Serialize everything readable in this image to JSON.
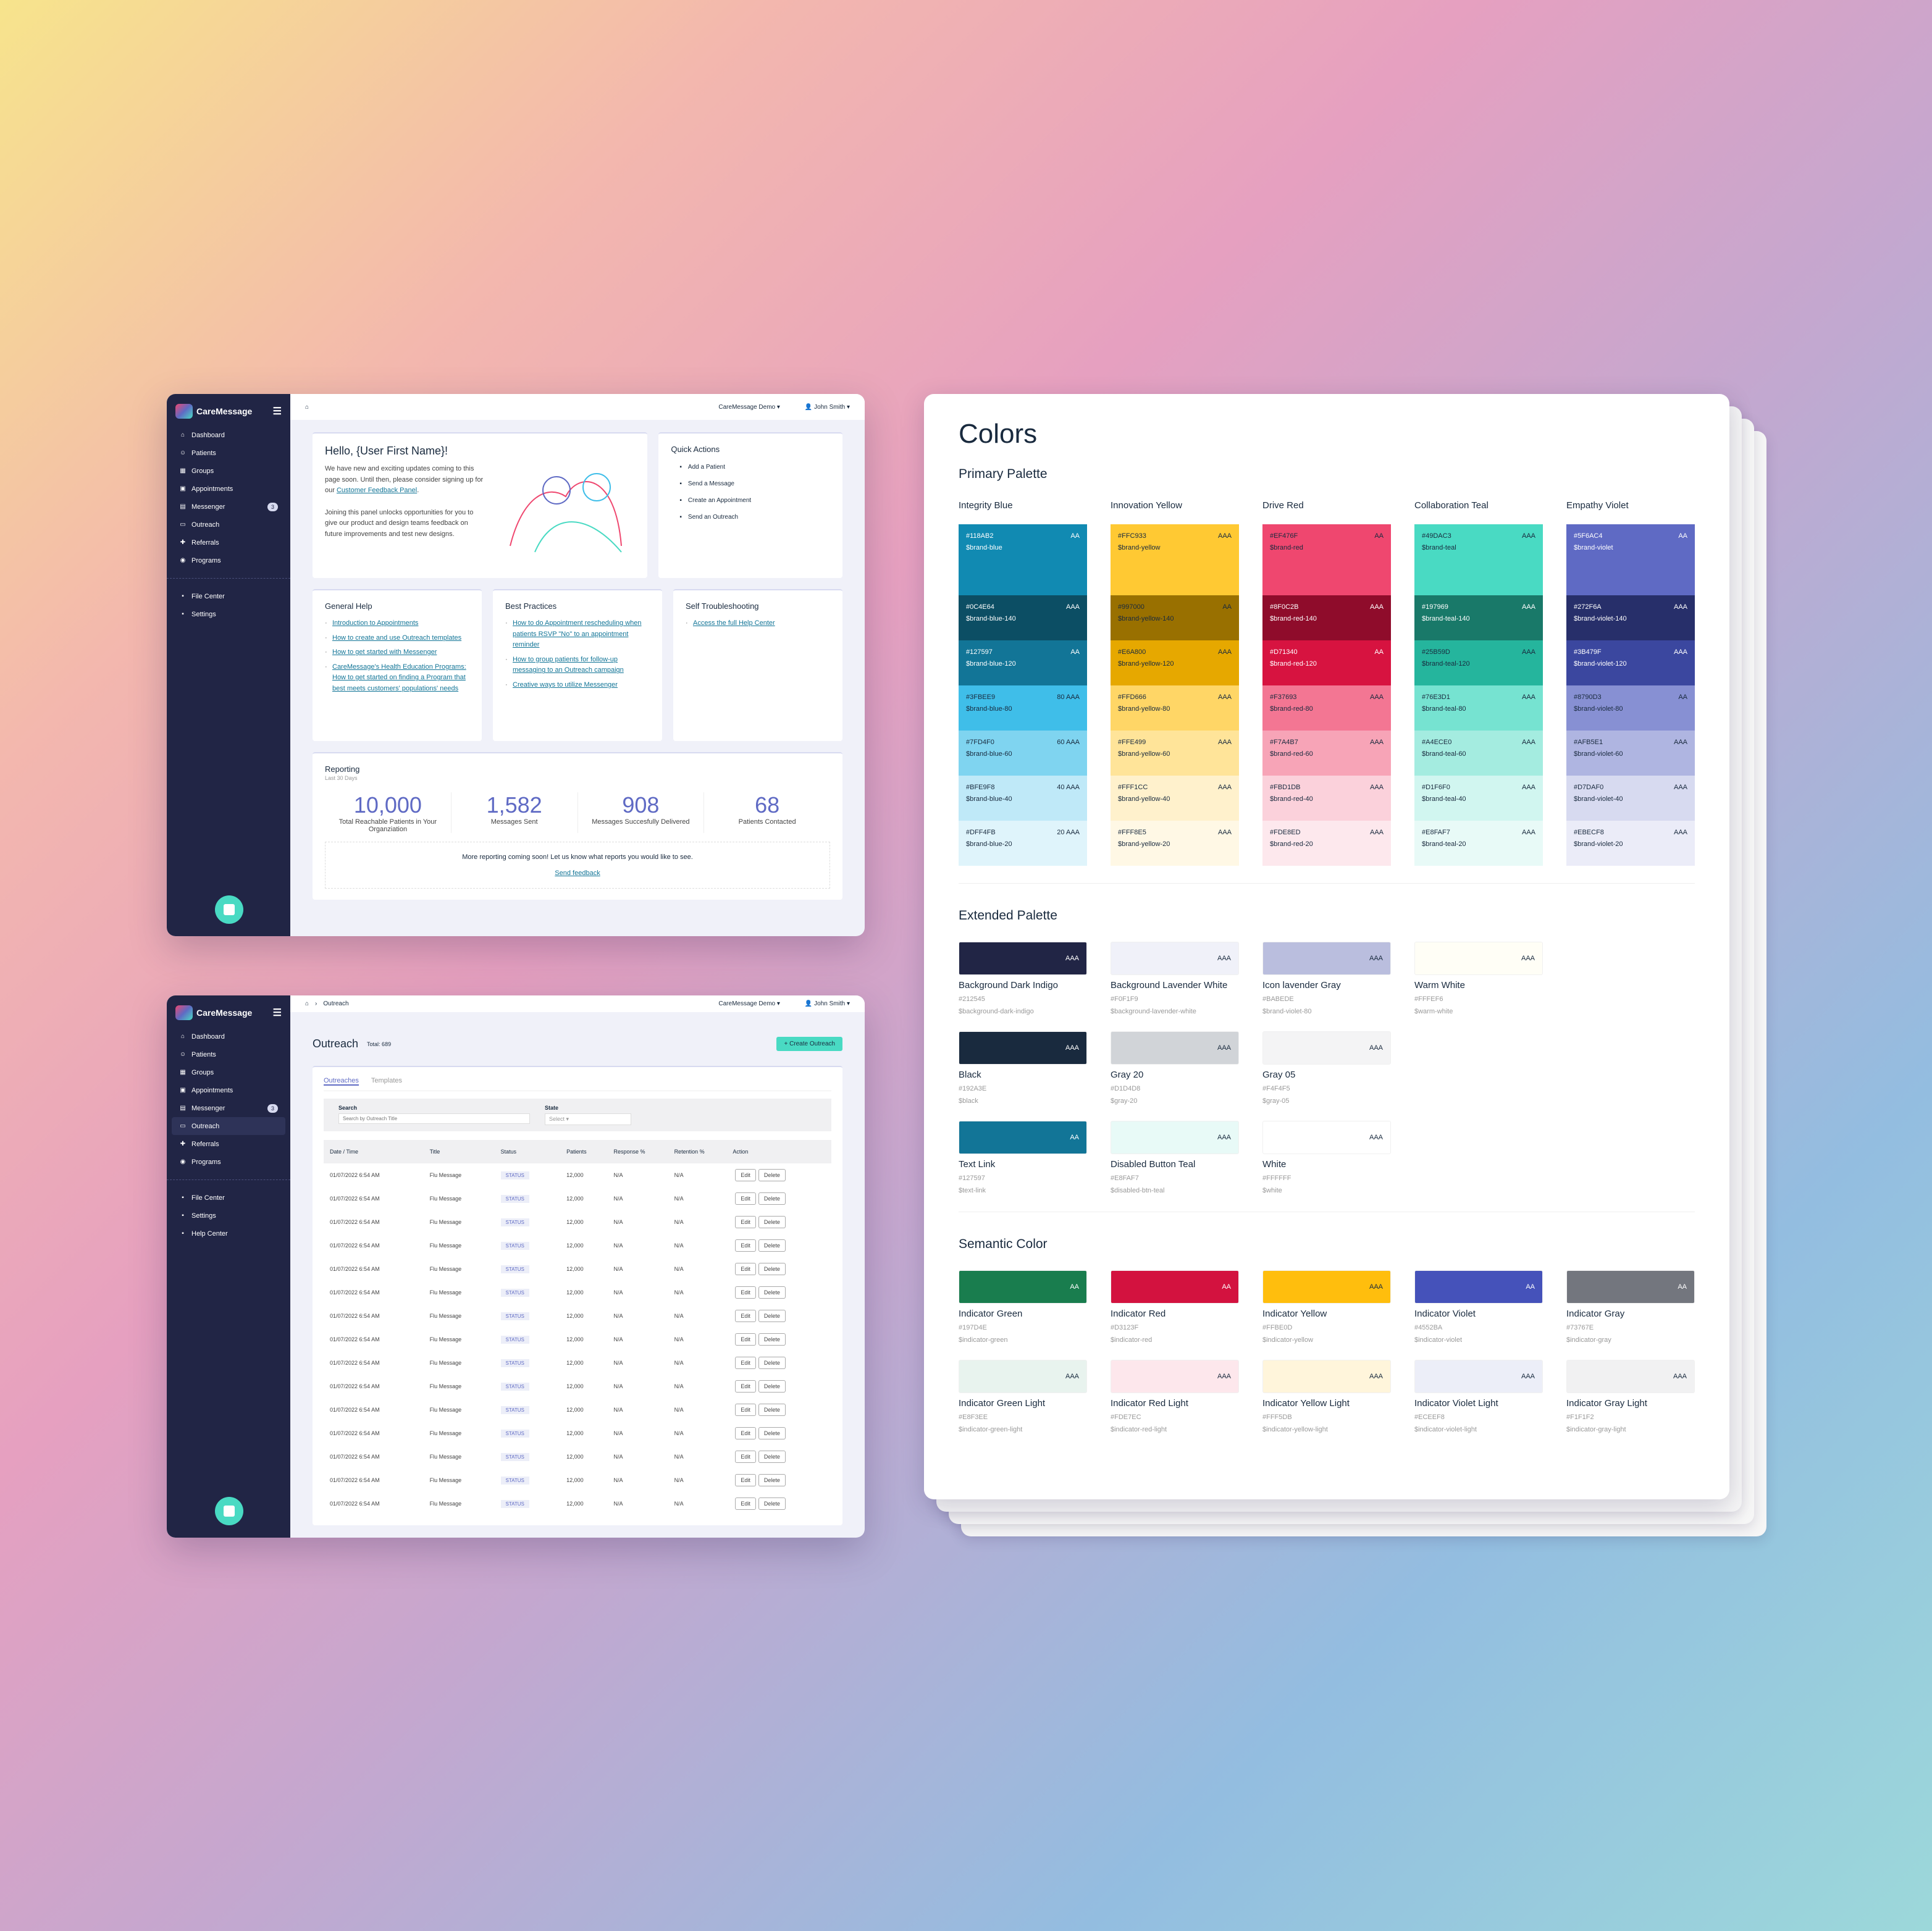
{
  "app": {
    "brand": "CareMessage",
    "org": "CareMessage Demo",
    "user": "John Smith"
  },
  "nav": {
    "items": [
      {
        "label": "Dashboard",
        "icon": "home-icon"
      },
      {
        "label": "Patients",
        "icon": "patients-icon"
      },
      {
        "label": "Groups",
        "icon": "groups-icon"
      },
      {
        "label": "Appointments",
        "icon": "calendar-icon"
      },
      {
        "label": "Messenger",
        "icon": "chat-icon",
        "badge": "3"
      },
      {
        "label": "Outreach",
        "icon": "outreach-icon"
      },
      {
        "label": "Referrals",
        "icon": "referral-icon"
      },
      {
        "label": "Programs",
        "icon": "programs-icon"
      }
    ],
    "bottom": [
      {
        "label": "File Center"
      },
      {
        "label": "Settings"
      },
      {
        "label": "Help Center"
      }
    ]
  },
  "dashboard": {
    "hello": "Hello, {User First Name}!",
    "p1": "We have new and exciting updates coming to this page soon. Until then, please consider signing up for our ",
    "p1_link": "Customer Feedback Panel",
    "p2": "Joining this panel unlocks opportunities for you to give our product and design teams feedback on future improvements and test new designs.",
    "quick": {
      "title": "Quick Actions",
      "items": [
        "Add a Patient",
        "Send a Message",
        "Create an Appointment",
        "Send an Outreach"
      ]
    },
    "general": {
      "title": "General Help",
      "links": [
        "Introduction to Appointments",
        "How to create and use Outreach templates",
        "How to get started with Messenger",
        "CareMessage's Health Education Programs: How to get started on finding a Program that best meets customers' populations' needs"
      ]
    },
    "best": {
      "title": "Best Practices",
      "links": [
        "How to do Appointment rescheduling when patients RSVP \"No\" to an appointment reminder",
        "How to group patients for follow-up messaging to an Outreach campaign",
        "Creative ways to utilize Messenger"
      ]
    },
    "self": {
      "title": "Self Troubleshooting",
      "links": [
        "Access the full Help Center"
      ]
    },
    "reporting": {
      "title": "Reporting",
      "sub": "Last 30 Days",
      "stats": [
        {
          "n": "10,000",
          "l": "Total Reachable Patients in Your Organziation"
        },
        {
          "n": "1,582",
          "l": "Messages Sent"
        },
        {
          "n": "908",
          "l": "Messages Succesfully Delivered"
        },
        {
          "n": "68",
          "l": "Patients Contacted"
        }
      ],
      "more": "More reporting coming soon! Let us know what reports you would like to see.",
      "feedback": "Send feedback"
    }
  },
  "outreach": {
    "crumb": "Outreach",
    "title": "Outreach",
    "total": "Total: 689",
    "create": "Create Outreach",
    "tabs": [
      "Outreaches",
      "Templates"
    ],
    "search_label": "Search",
    "search_ph": "Search by Outreach Title",
    "state_label": "State",
    "state_ph": "Select",
    "columns": [
      "Date / Time",
      "Title",
      "Status",
      "Patients",
      "Response %",
      "Retention %",
      "Action"
    ],
    "row": {
      "date": "01/07/2022 6:54 AM",
      "title": "Flu Message",
      "status": "STATUS",
      "patients": "12,000",
      "resp": "N/A",
      "ret": "N/A",
      "edit": "Edit",
      "del": "Delete"
    },
    "row_count": 15
  },
  "colors": {
    "title": "Colors",
    "primary_title": "Primary Palette",
    "primary": [
      {
        "name": "Integrity Blue",
        "sw": [
          [
            "#118AB2",
            "$brand-blue",
            "",
            "AA",
            "#fff"
          ],
          [
            "#0C4E64",
            "$brand-blue-140",
            "",
            "AAA",
            "#fff"
          ],
          [
            "#127597",
            "$brand-blue-120",
            "",
            "AA",
            "#fff"
          ],
          [
            "#3FBEE9",
            "$brand-blue-80",
            "80",
            "AAA",
            "#192A3E"
          ],
          [
            "#7FD4F0",
            "$brand-blue-60",
            "60",
            "AAA",
            "#192A3E"
          ],
          [
            "#BFE9F8",
            "$brand-blue-40",
            "40",
            "AAA",
            "#192A3E"
          ],
          [
            "#DFF4FB",
            "$brand-blue-20",
            "20",
            "AAA",
            "#192A3E"
          ]
        ]
      },
      {
        "name": "Innovation Yellow",
        "sw": [
          [
            "#FFC933",
            "$brand-yellow",
            "",
            "AAA",
            "#192A3E"
          ],
          [
            "#997000",
            "$brand-yellow-140",
            "",
            "AA",
            "#192A3E"
          ],
          [
            "#E6A800",
            "$brand-yellow-120",
            "",
            "AAA",
            "#192A3E"
          ],
          [
            "#FFD666",
            "$brand-yellow-80",
            "",
            "AAA",
            "#192A3E"
          ],
          [
            "#FFE499",
            "$brand-yellow-60",
            "",
            "AAA",
            "#192A3E"
          ],
          [
            "#FFF1CC",
            "$brand-yellow-40",
            "",
            "AAA",
            "#192A3E"
          ],
          [
            "#FFF8E5",
            "$brand-yellow-20",
            "",
            "AAA",
            "#192A3E"
          ]
        ]
      },
      {
        "name": "Drive Red",
        "sw": [
          [
            "#EF476F",
            "$brand-red",
            "",
            "AA",
            "#192A3E"
          ],
          [
            "#8F0C2B",
            "$brand-red-140",
            "",
            "AAA",
            "#fff"
          ],
          [
            "#D71340",
            "$brand-red-120",
            "",
            "AA",
            "#fff"
          ],
          [
            "#F37693",
            "$brand-red-80",
            "",
            "AAA",
            "#192A3E"
          ],
          [
            "#F7A4B7",
            "$brand-red-60",
            "",
            "AAA",
            "#192A3E"
          ],
          [
            "#FBD1DB",
            "$brand-red-40",
            "",
            "AAA",
            "#192A3E"
          ],
          [
            "#FDE8ED",
            "$brand-red-20",
            "",
            "AAA",
            "#192A3E"
          ]
        ]
      },
      {
        "name": "Collaboration Teal",
        "sw": [
          [
            "#49DAC3",
            "$brand-teal",
            "",
            "AAA",
            "#192A3E"
          ],
          [
            "#197969",
            "$brand-teal-140",
            "",
            "AAA",
            "#fff"
          ],
          [
            "#25B59D",
            "$brand-teal-120",
            "",
            "AAA",
            "#192A3E"
          ],
          [
            "#76E3D1",
            "$brand-teal-80",
            "",
            "AAA",
            "#192A3E"
          ],
          [
            "#A4ECE0",
            "$brand-teal-60",
            "",
            "AAA",
            "#192A3E"
          ],
          [
            "#D1F6F0",
            "$brand-teal-40",
            "",
            "AAA",
            "#192A3E"
          ],
          [
            "#E8FAF7",
            "$brand-teal-20",
            "",
            "AAA",
            "#192A3E"
          ]
        ]
      },
      {
        "name": "Empathy Violet",
        "sw": [
          [
            "#5F6AC4",
            "$brand-violet",
            "",
            "AA",
            "#fff"
          ],
          [
            "#272F6A",
            "$brand-violet-140",
            "",
            "AAA",
            "#fff"
          ],
          [
            "#3B479F",
            "$brand-violet-120",
            "",
            "AAA",
            "#fff"
          ],
          [
            "#8790D3",
            "$brand-violet-80",
            "",
            "AA",
            "#192A3E"
          ],
          [
            "#AFB5E1",
            "$brand-violet-60",
            "",
            "AAA",
            "#192A3E"
          ],
          [
            "#D7DAF0",
            "$brand-violet-40",
            "",
            "AAA",
            "#192A3E"
          ],
          [
            "#EBECF8",
            "$brand-violet-20",
            "",
            "AAA",
            "#192A3E"
          ]
        ]
      }
    ],
    "extended_title": "Extended Palette",
    "extended": [
      [
        "Background Dark Indigo",
        "#212545",
        "$background-dark-indigo",
        "AAA",
        "#fff"
      ],
      [
        "Background Lavender White",
        "#F0F1F9",
        "$background-lavender-white",
        "AAA",
        "#192A3E"
      ],
      [
        "Icon lavender Gray",
        "#BABEDE",
        "$brand-violet-80",
        "AAA",
        "#192A3E"
      ],
      [
        "Warm White",
        "#FFFEF6",
        "$warm-white",
        "AAA",
        "#192A3E"
      ],
      null,
      [
        "Black",
        "#192A3E",
        "$black",
        "AAA",
        "#fff"
      ],
      [
        "Gray 20",
        "#D1D4D8",
        "$gray-20",
        "AAA",
        "#192A3E"
      ],
      [
        "Gray 05",
        "#F4F4F5",
        "$gray-05",
        "AAA",
        "#192A3E"
      ],
      null,
      null,
      [
        "Text Link",
        "#127597",
        "$text-link",
        "AA",
        "#fff"
      ],
      [
        "Disabled Button Teal",
        "#E8FAF7",
        "$disabled-btn-teal",
        "AAA",
        "#192A3E"
      ],
      [
        "White",
        "#FFFFFF",
        "$white",
        "AAA",
        "#192A3E"
      ]
    ],
    "semantic_title": "Semantic Color",
    "semantic": [
      [
        "Indicator Green",
        "#197D4E",
        "$indicator-green",
        "AA",
        "#fff"
      ],
      [
        "Indicator Red",
        "#D3123F",
        "$indicator-red",
        "AA",
        "#fff"
      ],
      [
        "Indicator Yellow",
        "#FFBE0D",
        "$indicator-yellow",
        "AAA",
        "#192A3E"
      ],
      [
        "Indicator Violet",
        "#4552BA",
        "$indicator-violet",
        "AA",
        "#fff"
      ],
      [
        "Indicator Gray",
        "#73767E",
        "$indicator-gray",
        "AA",
        "#fff"
      ],
      [
        "Indicator Green Light",
        "#E8F3EE",
        "$indicator-green-light",
        "AAA",
        "#192A3E"
      ],
      [
        "Indicator Red Light",
        "#FDE7EC",
        "$indicator-red-light",
        "AAA",
        "#192A3E"
      ],
      [
        "Indicator Yellow Light",
        "#FFF5DB",
        "$indicator-yellow-light",
        "AAA",
        "#192A3E"
      ],
      [
        "Indicator Violet Light",
        "#ECEEF8",
        "$indicator-violet-light",
        "AAA",
        "#192A3E"
      ],
      [
        "Indicator Gray Light",
        "#F1F1F2",
        "$indicator-gray-light",
        "AAA",
        "#192A3E"
      ]
    ]
  }
}
